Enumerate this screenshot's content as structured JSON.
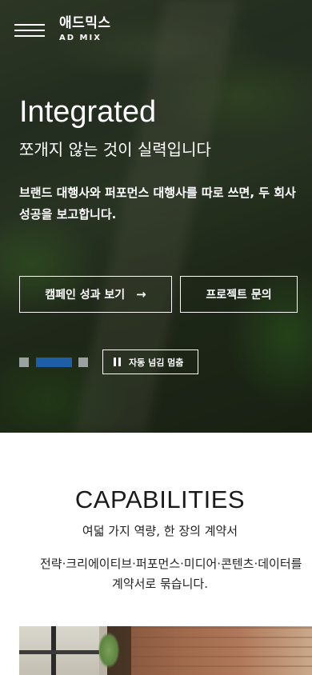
{
  "header": {
    "logo_ko": "애드믹스",
    "logo_en": "AD MIX"
  },
  "hero": {
    "title": "Integrated",
    "subtitle": "쪼개지 않는 것이 실력입니다",
    "description_line1": "브랜드 대행사와 퍼포먼스 대행사를 따로 쓰면, 두 회사",
    "description_line2": "성공을 보고합니다.",
    "primary_button": "캠페인 성과 보기",
    "primary_button_arrow": "→",
    "secondary_button": "프로젝트 문의",
    "autoplay_label": "자동 넘김 멈춤",
    "slides_total": 3,
    "active_slide": 2,
    "active_color": "#1e5ea8"
  },
  "capabilities": {
    "title": "CAPABILITIES",
    "subtitle": "여덟 가지 역량, 한 장의 계약서",
    "description_line1": "전략·크리에이티브·퍼포먼스·미디어·콘텐츠·데이터를",
    "description_line2": "계약서로 묶습니다."
  }
}
